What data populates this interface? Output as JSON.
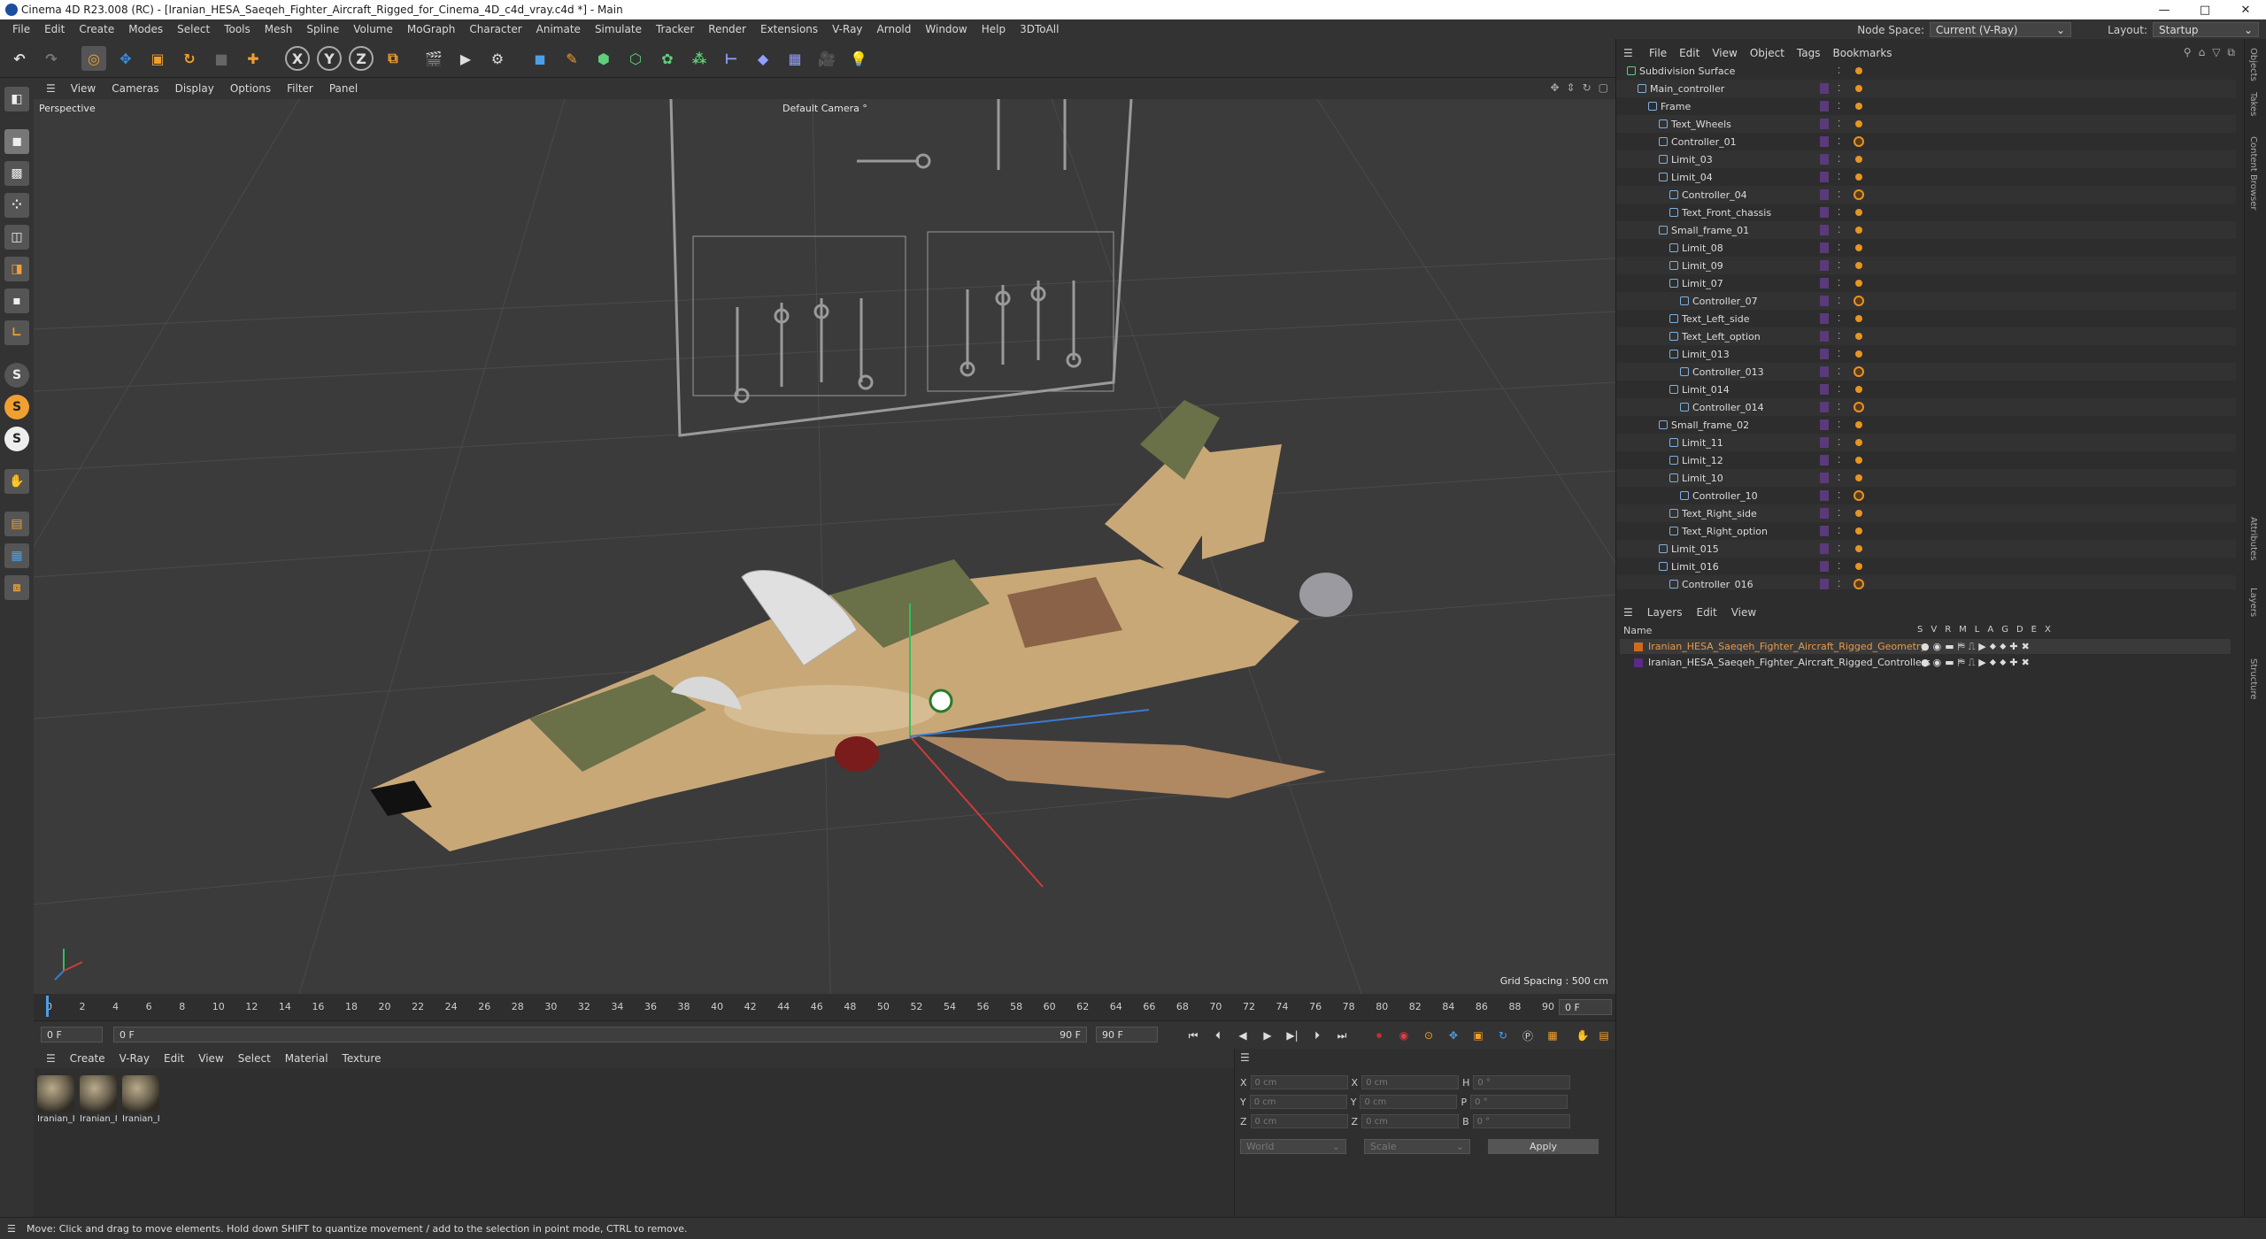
{
  "window": {
    "title": "Cinema 4D R23.008 (RC) - [Iranian_HESA_Saeqeh_Fighter_Aircraft_Rigged_for_Cinema_4D_c4d_vray.c4d *] - Main",
    "min": "—",
    "max": "□",
    "close": "✕"
  },
  "menubar": [
    "File",
    "Edit",
    "Create",
    "Modes",
    "Select",
    "Tools",
    "Mesh",
    "Spline",
    "Volume",
    "MoGraph",
    "Character",
    "Animate",
    "Simulate",
    "Tracker",
    "Render",
    "Extensions",
    "V-Ray",
    "Arnold",
    "Window",
    "Help",
    "3DToAll"
  ],
  "node_space": {
    "label": "Node Space:",
    "value": "Current (V-Ray)"
  },
  "layout": {
    "label": "Layout:",
    "value": "Startup"
  },
  "toolbar": {
    "x": "X",
    "y": "Y",
    "z": "Z"
  },
  "side_tool_letters": [
    "S",
    "S",
    "S"
  ],
  "viewport": {
    "menu": [
      "View",
      "Cameras",
      "Display",
      "Options",
      "Filter",
      "Panel"
    ],
    "projection": "Perspective",
    "camera": "Default Camera °",
    "grid_spacing": "Grid Spacing : 500 cm"
  },
  "timeline": {
    "ticks": [
      "0",
      "2",
      "4",
      "6",
      "8",
      "10",
      "12",
      "14",
      "16",
      "18",
      "20",
      "22",
      "24",
      "26",
      "28",
      "30",
      "32",
      "34",
      "36",
      "38",
      "40",
      "42",
      "44",
      "46",
      "48",
      "50",
      "52",
      "54",
      "56",
      "58",
      "60",
      "62",
      "64",
      "66",
      "68",
      "70",
      "72",
      "74",
      "76",
      "78",
      "80",
      "82",
      "84",
      "86",
      "88",
      "90"
    ],
    "current_frame": "0 F"
  },
  "transport": {
    "start": "0 F",
    "current": "0 F",
    "end1": "90 F",
    "end2": "90 F"
  },
  "material_manager": {
    "menu": [
      "Create",
      "V-Ray",
      "Edit",
      "View",
      "Select",
      "Material",
      "Texture"
    ],
    "materials": [
      "Iranian_I",
      "Iranian_I",
      "Iranian_I"
    ]
  },
  "coordinates": {
    "rows": [
      {
        "a": "X",
        "av": "0 cm",
        "b": "X",
        "bv": "0 cm",
        "c": "H",
        "cv": "0 °"
      },
      {
        "a": "Y",
        "av": "0 cm",
        "b": "Y",
        "bv": "0 cm",
        "c": "P",
        "cv": "0 °"
      },
      {
        "a": "Z",
        "av": "0 cm",
        "b": "Z",
        "bv": "0 cm",
        "c": "B",
        "cv": "0 °"
      }
    ],
    "mode1": "World",
    "mode2": "Scale",
    "apply": "Apply"
  },
  "object_manager": {
    "menu": [
      "File",
      "Edit",
      "View",
      "Object",
      "Tags",
      "Bookmarks"
    ],
    "objects": [
      "Subdivision Surface",
      "Main_controller",
      "Frame",
      "Text_Wheels",
      "Controller_01",
      "Limit_03",
      "Limit_04",
      "Controller_04",
      "Text_Front_chassis",
      "Small_frame_01",
      "Limit_08",
      "Limit_09",
      "Limit_07",
      "Controller_07",
      "Text_Left_side",
      "Text_Left_option",
      "Limit_013",
      "Controller_013",
      "Limit_014",
      "Controller_014",
      "Small_frame_02",
      "Limit_11",
      "Limit_12",
      "Limit_10",
      "Controller_10",
      "Text_Right_side",
      "Text_Right_option",
      "Limit_015",
      "Limit_016",
      "Controller_016"
    ]
  },
  "layer_manager": {
    "menu": [
      "Layers",
      "Edit",
      "View"
    ],
    "name_header": "Name",
    "flags": [
      "S",
      "V",
      "R",
      "M",
      "L",
      "A",
      "G",
      "D",
      "E",
      "X"
    ],
    "layers": [
      "Iranian_HESA_Saeqeh_Fighter_Aircraft_Rigged_Geometry",
      "Iranian_HESA_Saeqeh_Fighter_Aircraft_Rigged_Controllers"
    ]
  },
  "side_tabs": [
    "Objects",
    "Takes",
    "Content Browser",
    "Attributes",
    "Layers",
    "Structure"
  ],
  "status": "Move: Click and drag to move elements. Hold down SHIFT to quantize movement / add to the selection in point mode, CTRL to remove."
}
